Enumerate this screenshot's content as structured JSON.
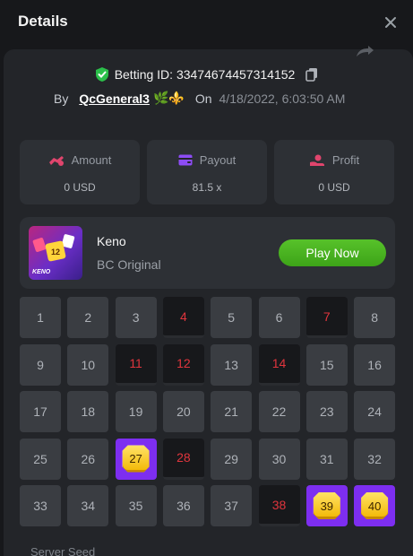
{
  "header": {
    "title": "Details"
  },
  "bet": {
    "betting_id_text": "Betting ID: 33474674457314152",
    "by_label": "By",
    "username": "QcGeneral3",
    "username_emojis": "🌿⚜️",
    "on_label": "On",
    "date": "4/18/2022, 6:03:50 AM"
  },
  "stats": [
    {
      "label": "Amount",
      "value": "0 USD",
      "icon": "coins-icon",
      "color": "#e0456d"
    },
    {
      "label": "Payout",
      "value": "81.5 x",
      "icon": "wallet-icon",
      "color": "#8d4cf5"
    },
    {
      "label": "Profit",
      "value": "0 USD",
      "icon": "profit-icon",
      "color": "#e0456d"
    }
  ],
  "game": {
    "name": "Keno",
    "subtitle": "BC Original",
    "play_label": "Play Now",
    "thumb_label": "KENO",
    "thumb_tile_number": "12"
  },
  "keno": {
    "numbers": [
      1,
      2,
      3,
      4,
      5,
      6,
      7,
      8,
      9,
      10,
      11,
      12,
      13,
      14,
      15,
      16,
      17,
      18,
      19,
      20,
      21,
      22,
      23,
      24,
      25,
      26,
      27,
      28,
      29,
      30,
      31,
      32,
      33,
      34,
      35,
      36,
      37,
      38,
      39,
      40
    ],
    "picked_missed": [
      4,
      7,
      11,
      12,
      14,
      28,
      38
    ],
    "hits": [
      27,
      39,
      40
    ]
  },
  "footer": {
    "server_seed_label": "Server Seed"
  },
  "colors": {
    "accent_green": "#3da418",
    "hit_purple": "#7d2ef0",
    "missed_red": "#e0353d",
    "shield_green": "#2bbf4a"
  }
}
